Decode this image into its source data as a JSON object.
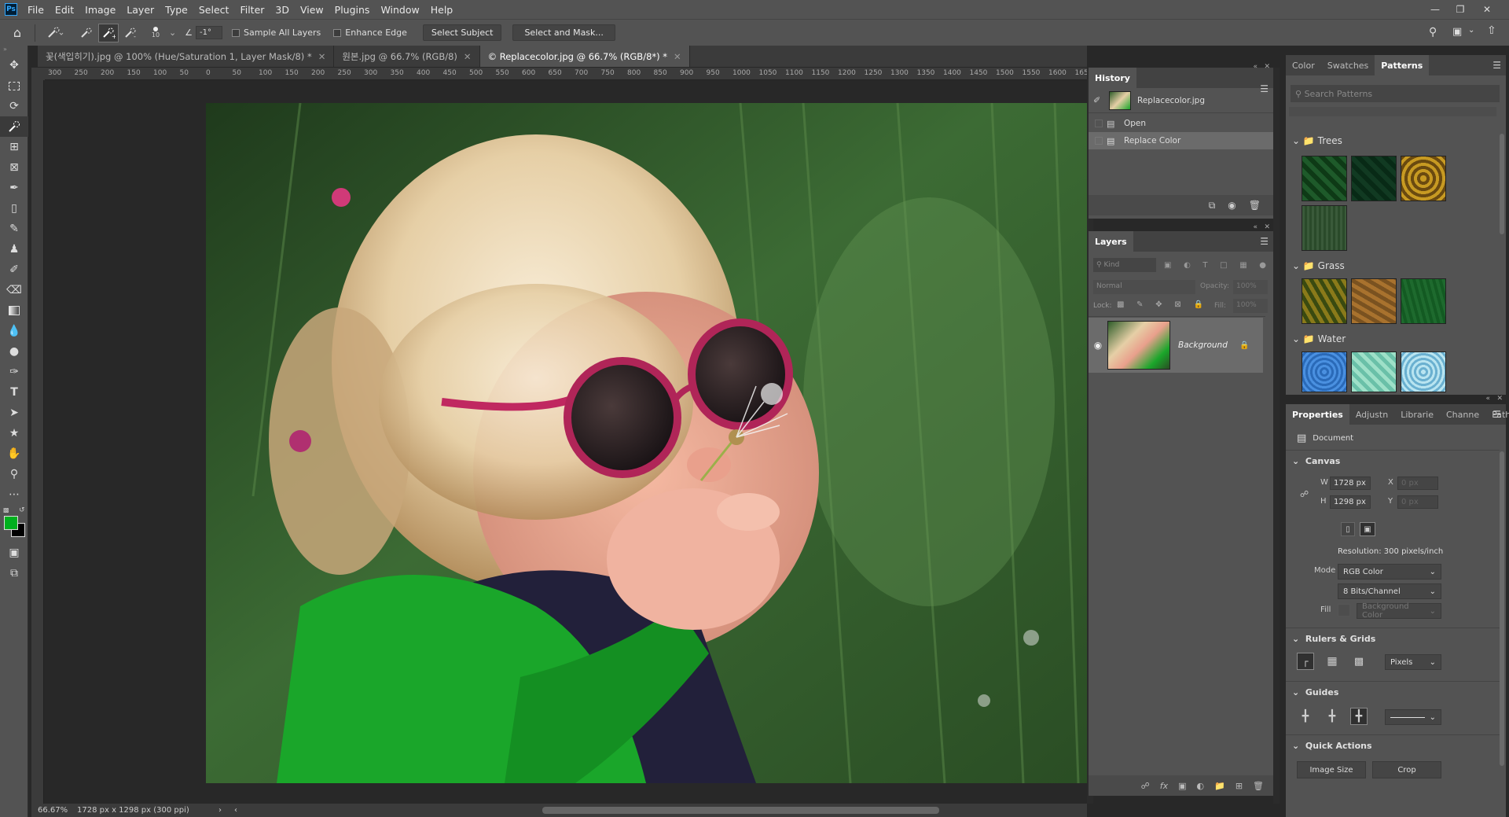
{
  "menubar": {
    "logo": "Ps",
    "items": [
      "File",
      "Edit",
      "Image",
      "Layer",
      "Type",
      "Select",
      "Filter",
      "3D",
      "View",
      "Plugins",
      "Window",
      "Help"
    ]
  },
  "options": {
    "brush_size": "10",
    "angle": "-1°",
    "sample_all_layers": "Sample All Layers",
    "enhance_edge": "Enhance Edge",
    "select_subject": "Select Subject",
    "select_and_mask": "Select and Mask..."
  },
  "doc_tabs": [
    {
      "label": "꽃(색입히기).jpg @ 100% (Hue/Saturation 1, Layer Mask/8) *"
    },
    {
      "label": "원본.jpg @ 66.7% (RGB/8)"
    },
    {
      "label": "© Replacecolor.jpg @ 66.7% (RGB/8*) *"
    }
  ],
  "ruler_labels": [
    "300",
    "250",
    "200",
    "150",
    "100",
    "50",
    "0",
    "50",
    "100",
    "150",
    "200",
    "250",
    "300",
    "350",
    "400",
    "450",
    "500",
    "550",
    "600",
    "650",
    "700",
    "750",
    "800",
    "850",
    "900",
    "950",
    "1000",
    "1050",
    "1100",
    "1150",
    "1200",
    "1250",
    "1300",
    "1350",
    "1400",
    "1450",
    "1500",
    "1550",
    "1600",
    "1650"
  ],
  "status": {
    "zoom": "66.67%",
    "doc_info": "1728 px x 1298 px (300 ppi)"
  },
  "history": {
    "title": "History",
    "snapshot": "Replacecolor.jpg",
    "items": [
      "Open",
      "Replace Color"
    ]
  },
  "layers": {
    "title": "Layers",
    "kind": "Kind",
    "blend": "Normal",
    "opacity_label": "Opacity:",
    "opacity_value": "100%",
    "lock_label": "Lock:",
    "fill_label": "Fill:",
    "fill_value": "100%",
    "layer_name": "Background"
  },
  "patterns_panel": {
    "tabs": [
      "Color",
      "Swatches",
      "Patterns"
    ],
    "search_placeholder": "Search Patterns",
    "groups": [
      "Trees",
      "Grass",
      "Water"
    ]
  },
  "properties": {
    "tabs": [
      "Properties",
      "Adjustn",
      "Librarie",
      "Channe",
      "Paths"
    ],
    "document": "Document",
    "canvas": "Canvas",
    "w_label": "W",
    "w_value": "1728 px",
    "h_label": "H",
    "h_value": "1298 px",
    "x_label": "X",
    "x_value": "0 px",
    "y_label": "Y",
    "y_value": "0 px",
    "resolution": "Resolution: 300 pixels/inch",
    "mode_label": "Mode",
    "mode_value": "RGB Color",
    "bits_value": "8 Bits/Channel",
    "fill_label": "Fill",
    "fill_value": "Background Color",
    "rulers_grids": "Rulers & Grids",
    "units_value": "Pixels",
    "guides": "Guides",
    "quick_actions": "Quick Actions",
    "image_size": "Image Size",
    "crop": "Crop"
  },
  "colors": {
    "foreground": "#00b01e",
    "background": "#000000"
  }
}
